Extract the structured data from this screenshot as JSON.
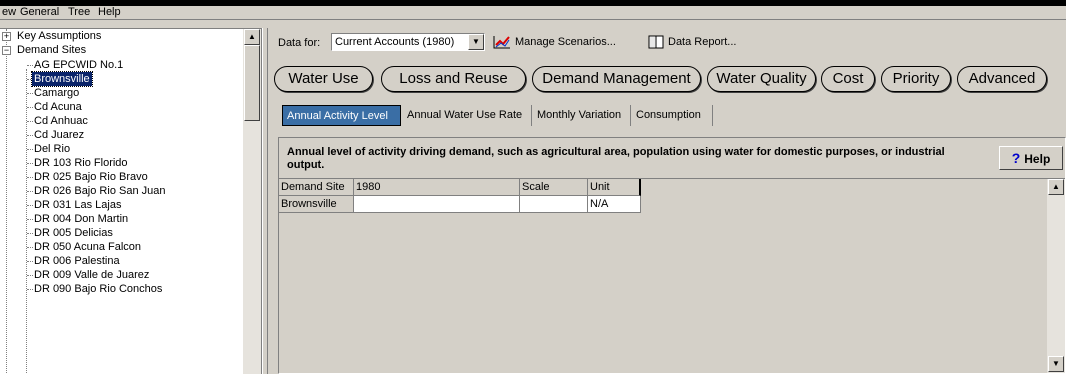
{
  "menu": [
    "ew",
    "General",
    "Tree",
    "Help"
  ],
  "tree": {
    "items": [
      {
        "label": "Key Assumptions",
        "expander": "+"
      },
      {
        "label": "Demand Sites",
        "expander": "−"
      },
      {
        "label": "AG EPCWID No.1"
      },
      {
        "label": "Brownsville",
        "selected": true
      },
      {
        "label": "Camargo"
      },
      {
        "label": "Cd Acuna"
      },
      {
        "label": "Cd Anhuac"
      },
      {
        "label": "Cd Juarez"
      },
      {
        "label": "Del Rio"
      },
      {
        "label": "DR 103 Rio Florido"
      },
      {
        "label": "DR 025 Bajo Rio Bravo"
      },
      {
        "label": "DR 026 Bajo Rio San Juan"
      },
      {
        "label": "DR 031 Las Lajas"
      },
      {
        "label": "DR 004 Don Martin"
      },
      {
        "label": "DR 005 Delicias"
      },
      {
        "label": "DR 050 Acuna Falcon"
      },
      {
        "label": "DR 006 Palestina"
      },
      {
        "label": "DR 009 Valle de Juarez"
      },
      {
        "label": "DR 090 Bajo Rio Conchos"
      }
    ]
  },
  "toolbar": {
    "data_for_label": "Data for:",
    "scenario_value": "Current Accounts (1980)",
    "manage_scenarios": "Manage Scenarios...",
    "data_report": "Data Report..."
  },
  "category_tabs": [
    "Water Use",
    "Loss and Reuse",
    "Demand Management",
    "Water Quality",
    "Cost",
    "Priority",
    "Advanced"
  ],
  "sub_tabs": [
    "Annual Activity Level",
    "Annual Water Use Rate",
    "Monthly Variation",
    "Consumption"
  ],
  "description": "Annual level of activity driving demand, such as agricultural area, population using water for domestic purposes, or industrial output.",
  "help_label": "Help",
  "table": {
    "headers": [
      "Demand Site",
      "1980",
      "Scale",
      "Unit"
    ],
    "rows": [
      [
        "Brownsville",
        "",
        "",
        "N/A"
      ]
    ]
  },
  "colors": {
    "active_tab": "#3a6ea5",
    "selection": "#0a246a",
    "chrome": "#d4d0c8"
  },
  "icons": {
    "manage_scenarios": "chart-line-icon",
    "data_report": "book-icon",
    "help": "question-icon"
  }
}
